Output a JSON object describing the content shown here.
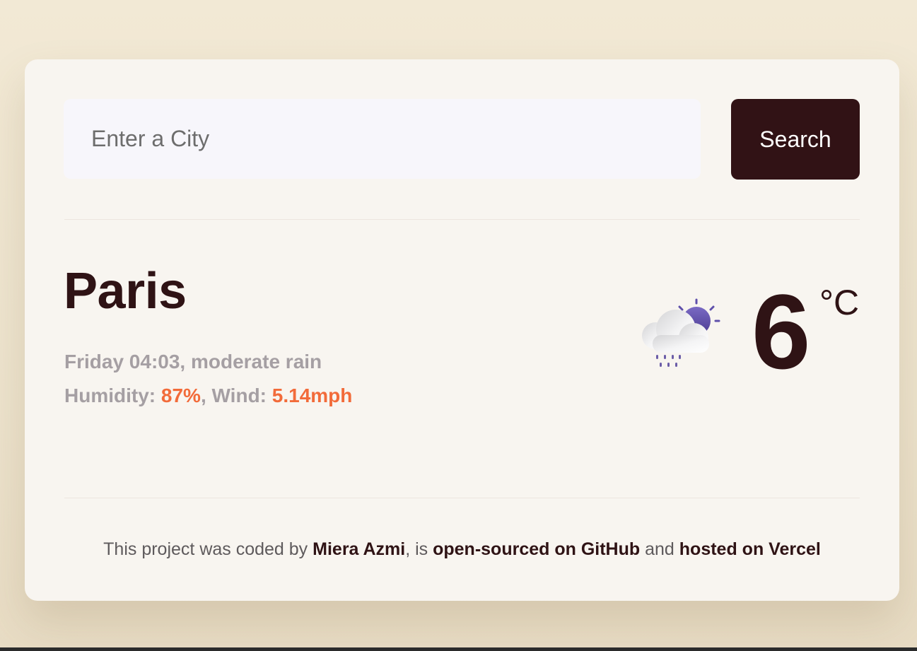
{
  "search": {
    "placeholder": "Enter a City",
    "value": "",
    "button_label": "Search"
  },
  "weather": {
    "city": "Paris",
    "day_time": "Friday 04:03",
    "description": "moderate rain",
    "humidity_label": "Humidity:",
    "humidity": "87%",
    "wind_label": "Wind:",
    "wind": "5.14mph",
    "temperature": "6",
    "unit": "°C",
    "icon": "rain-cloud-with-sun-icon"
  },
  "footer": {
    "prefix": "This project was coded by",
    "author": "Miera Azmi",
    "middle": ", is",
    "github_link": "open-sourced on GitHub",
    "conjunction": "and",
    "host_link": "hosted on Vercel"
  },
  "colors": {
    "page_background": "#f2e9d5",
    "card_background": "#f8f5f0",
    "primary_dark": "#311215",
    "accent": "#f26b3a",
    "muted_text": "#a59fa3",
    "input_background": "#f7f6fb"
  }
}
